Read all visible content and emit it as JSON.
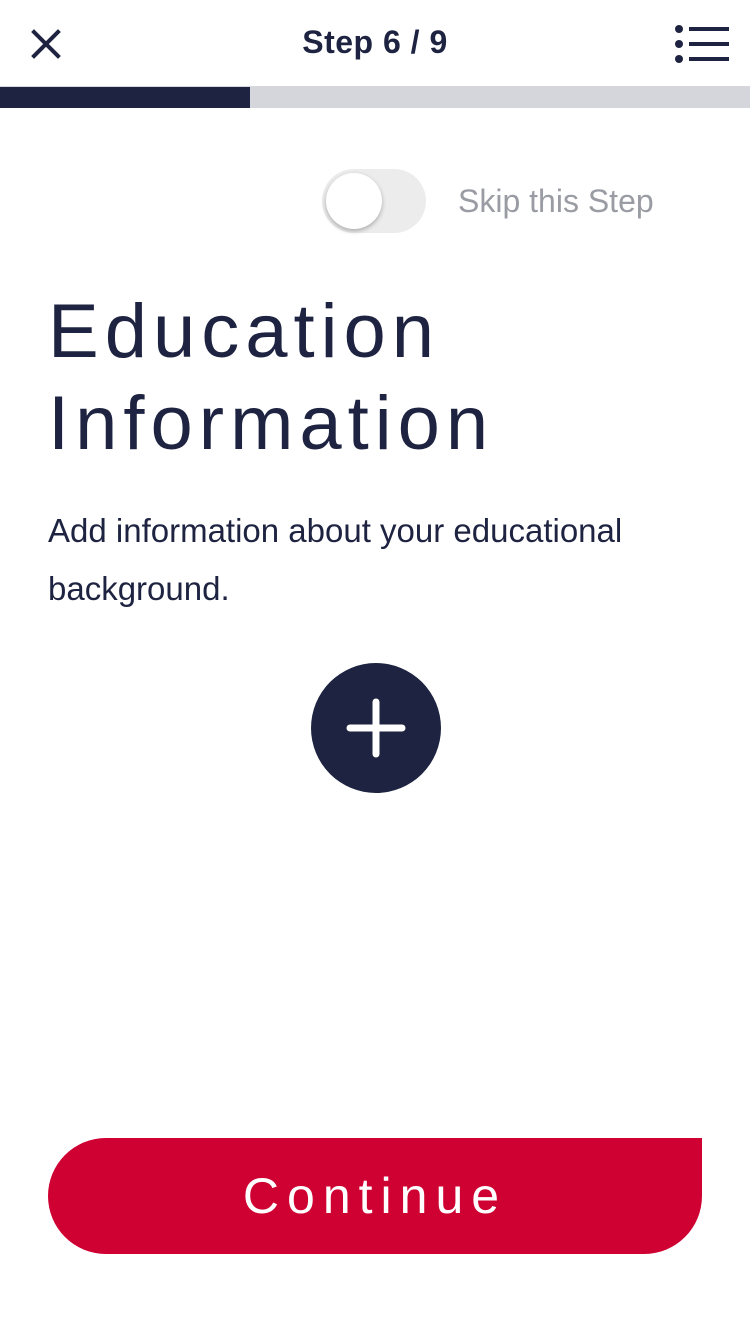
{
  "header": {
    "step_title": "Step 6 / 9",
    "close_icon": "close-icon",
    "menu_icon": "list-icon"
  },
  "progress": {
    "current_step": 6,
    "total_steps": 9,
    "fill_fraction": 0.333,
    "fill_color": "#1d2340",
    "track_color": "#d4d6dc"
  },
  "skip": {
    "label": "Skip this Step",
    "toggle_on": false
  },
  "main": {
    "title": "Education Information",
    "description": "Add information about your educational background.",
    "add_icon": "plus-icon"
  },
  "footer": {
    "continue_label": "Continue",
    "continue_color": "#cf0032"
  },
  "colors": {
    "primary": "#1d2340",
    "accent": "#cf0032",
    "muted_text": "#9a9ca3"
  }
}
